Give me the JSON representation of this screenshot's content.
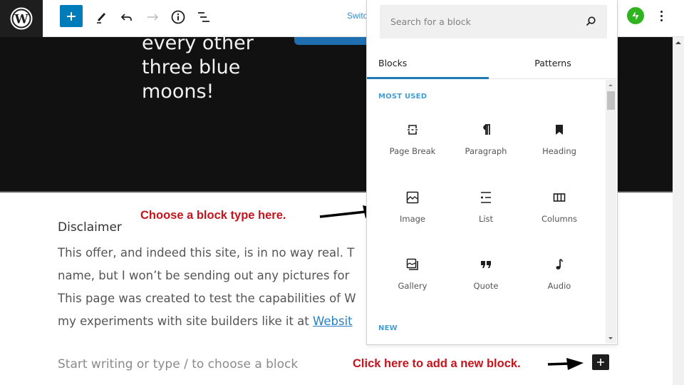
{
  "toolbar": {
    "logo": "wordpress-logo",
    "add_block": "Add block",
    "tools": "tools-icon",
    "undo": "undo-icon",
    "redo": "redo-icon",
    "details": "info-icon",
    "list_view": "list-view-icon",
    "switch_link": "Switch",
    "jetpack": "jetpack-icon",
    "options": "more-options-icon"
  },
  "hero": {
    "lines": [
      "every other",
      "three blue",
      "moons!"
    ]
  },
  "content": {
    "disclaimer_title": "Disclaimer",
    "paragraph_lines": [
      "This offer, and indeed this site, is in no way real. T",
      "name, but I won’t be sending out any pictures for",
      "This page was created to test the capabilities of W",
      "my experiments with site builders like it at "
    ],
    "link_text": "Websit",
    "placeholder": "Start writing or type / to choose a block"
  },
  "annotations": {
    "choose_block": "Choose a block type here.",
    "add_new": "Click here to add a new block.",
    "color": "#c5141c"
  },
  "inserter": {
    "search_placeholder": "Search for a block",
    "tabs": [
      {
        "label": "Blocks",
        "active": true
      },
      {
        "label": "Patterns",
        "active": false
      }
    ],
    "sections": [
      {
        "label": "MOST USED",
        "blocks": [
          {
            "label": "Page Break",
            "icon": "page-break-icon"
          },
          {
            "label": "Paragraph",
            "icon": "paragraph-icon"
          },
          {
            "label": "Heading",
            "icon": "heading-icon"
          },
          {
            "label": "Image",
            "icon": "image-icon"
          },
          {
            "label": "List",
            "icon": "list-icon"
          },
          {
            "label": "Columns",
            "icon": "columns-icon"
          },
          {
            "label": "Gallery",
            "icon": "gallery-icon"
          },
          {
            "label": "Quote",
            "icon": "quote-icon"
          },
          {
            "label": "Audio",
            "icon": "audio-icon"
          }
        ]
      },
      {
        "label": "NEW",
        "blocks": []
      }
    ]
  },
  "colors": {
    "accent": "#007cba",
    "toolbar_dark": "#1e1e1e",
    "hero_bg": "#111111",
    "section_label": "#3fa0d4",
    "jetpack": "#2fb41f"
  }
}
